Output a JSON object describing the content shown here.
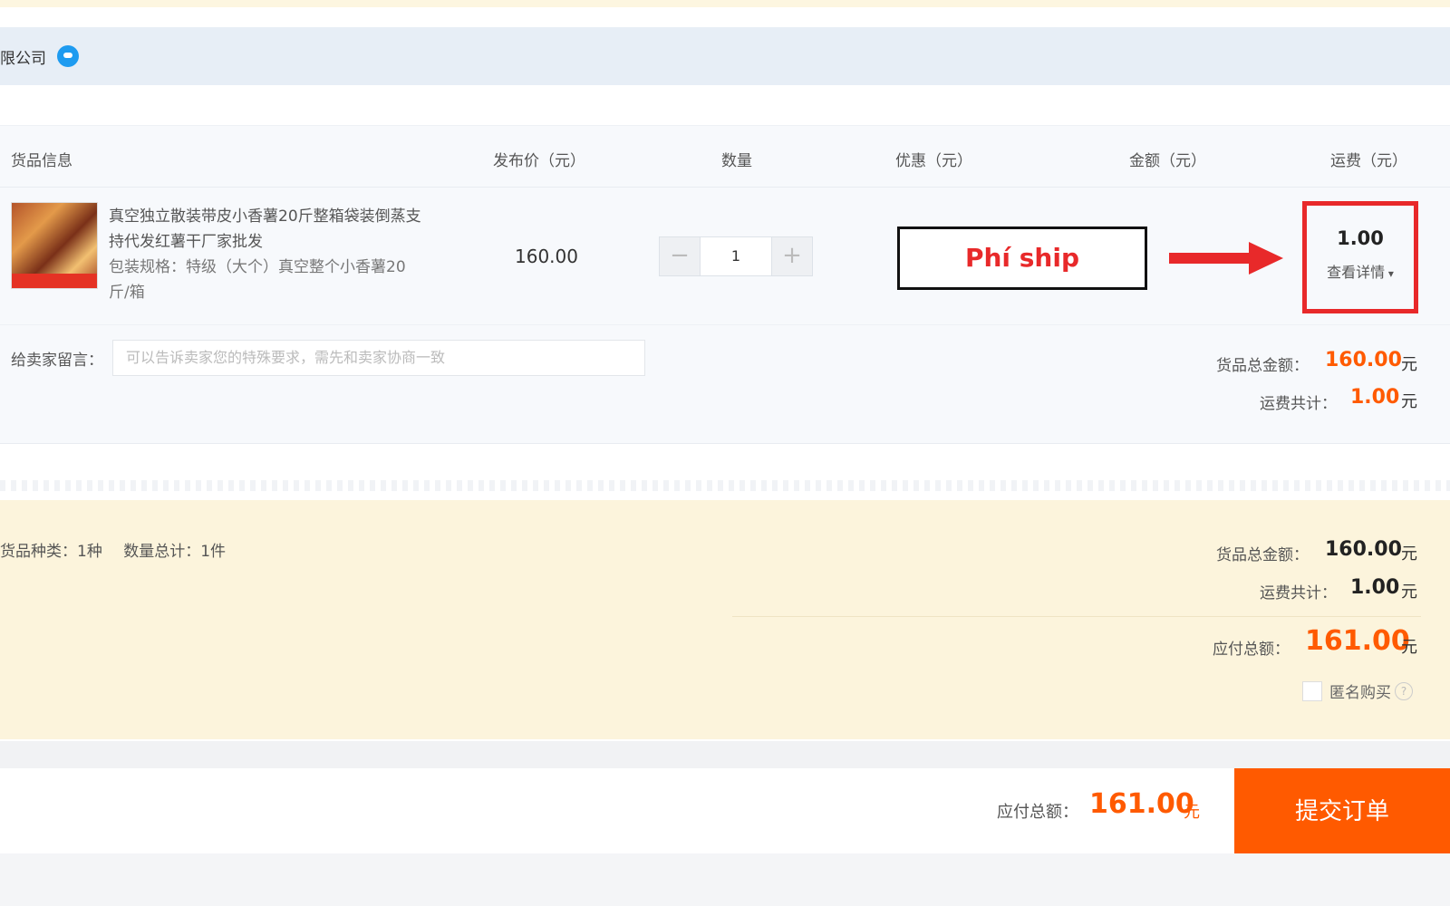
{
  "shop": {
    "name": "限公司",
    "chat_icon": "wangwang-chat-icon"
  },
  "table": {
    "headers": {
      "product": "货品信息",
      "price": "发布价（元）",
      "quantity": "数量",
      "discount": "优惠（元）",
      "amount": "金额（元）",
      "shipping": "运费（元）"
    },
    "item": {
      "title": "真空独立散装带皮小香薯20斤整箱袋装倒蒸支持代发红薯干厂家批发",
      "spec": "包装规格：特级（大个）真空整个小香薯20斤/箱",
      "price": "160.00",
      "qty": "1",
      "shipping_fee": "1.00",
      "shipping_detail": "查看详情"
    },
    "memo": {
      "label": "给卖家留言：",
      "placeholder": "可以告诉卖家您的特殊要求，需先和卖家协商一致"
    },
    "subtotal": {
      "goods_label": "货品总金额：",
      "goods_value": "160.00",
      "shipping_label": "运费共计：",
      "shipping_value": "1.00",
      "unit": "元"
    }
  },
  "annotation": {
    "text": "Phí ship",
    "color": "#e8292a"
  },
  "summary": {
    "kinds": "货品种类：1种",
    "count": "数量总计：1件",
    "goods_label": "货品总金额：",
    "goods_value": "160.00",
    "shipping_label": "运费共计：",
    "shipping_value": "1.00",
    "total_label": "应付总额：",
    "total_value": "161.00",
    "unit": "元",
    "anonymous": "匿名购买"
  },
  "footer": {
    "total_label": "应付总额：",
    "total_value": "161.00",
    "unit": "元",
    "submit": "提交订单"
  },
  "colors": {
    "accent": "#ff5a00",
    "annotation_red": "#e8292a"
  }
}
